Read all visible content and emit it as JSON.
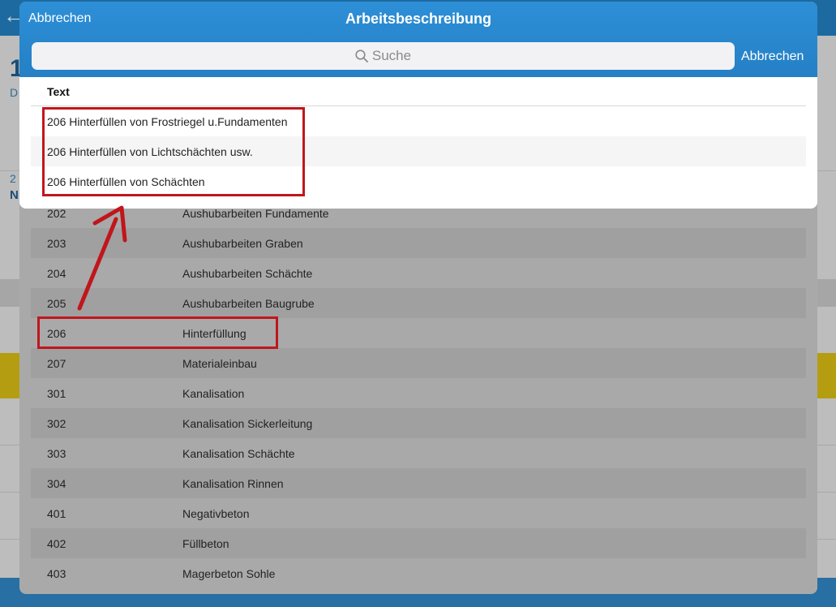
{
  "modal": {
    "cancel_left": "Abbrechen",
    "title": "Arbeitsbeschreibung",
    "search_placeholder": "Suche",
    "cancel_right": "Abbrechen"
  },
  "results": {
    "column_header": "Text",
    "rows": [
      "206 Hinterfüllen von Frostriegel u.Fundamenten",
      "206 Hinterfüllen von Lichtschächten usw.",
      "206 Hinterfüllen von Schächten"
    ]
  },
  "list": [
    {
      "code": "202",
      "label": "Aushubarbeiten Fundamente"
    },
    {
      "code": "203",
      "label": "Aushubarbeiten Graben"
    },
    {
      "code": "204",
      "label": "Aushubarbeiten Schächte"
    },
    {
      "code": "205",
      "label": "Aushubarbeiten Baugrube"
    },
    {
      "code": "206",
      "label": "Hinterfüllung"
    },
    {
      "code": "207",
      "label": "Materialeinbau"
    },
    {
      "code": "301",
      "label": "Kanalisation"
    },
    {
      "code": "302",
      "label": "Kanalisation Sickerleitung"
    },
    {
      "code": "303",
      "label": "Kanalisation Schächte"
    },
    {
      "code": "304",
      "label": "Kanalisation Rinnen"
    },
    {
      "code": "401",
      "label": "Negativbeton"
    },
    {
      "code": "402",
      "label": "Füllbeton"
    },
    {
      "code": "403",
      "label": "Magerbeton Sohle"
    }
  ],
  "colors": {
    "header_blue": "#2d8fd7",
    "annotation_red": "#c0161c"
  }
}
